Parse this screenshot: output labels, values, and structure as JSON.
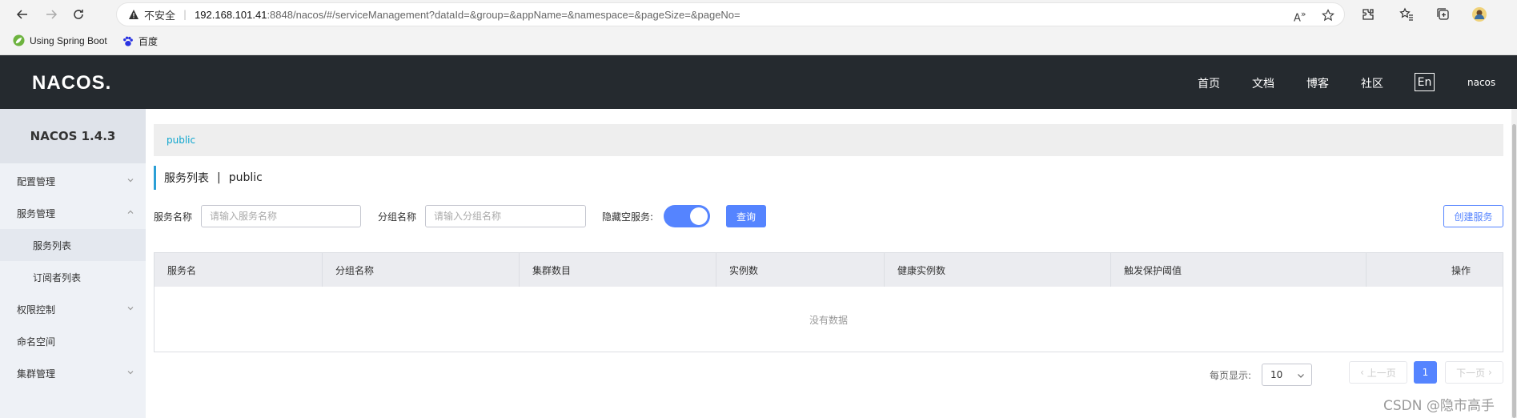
{
  "browser": {
    "insecure_label": "不安全",
    "url_host": "192.168.101.41",
    "url_rest": ":8848/nacos/#/serviceManagement?dataId=&group=&appName=&namespace=&pageSize=&pageNo=",
    "bookmarks": [
      {
        "label": "Using Spring Boot",
        "icon": "spring-leaf-icon"
      },
      {
        "label": "百度",
        "icon": "baidu-paw-icon"
      }
    ]
  },
  "header": {
    "logo": "NACOS.",
    "menu": [
      "首页",
      "文档",
      "博客",
      "社区"
    ],
    "lang": "En",
    "user": "nacos"
  },
  "sidebar": {
    "title": "NACOS 1.4.3",
    "items": [
      {
        "label": "配置管理",
        "type": "group",
        "expanded": false
      },
      {
        "label": "服务管理",
        "type": "group",
        "expanded": true
      },
      {
        "label": "服务列表",
        "type": "sub",
        "active": true
      },
      {
        "label": "订阅者列表",
        "type": "sub"
      },
      {
        "label": "权限控制",
        "type": "group",
        "expanded": false
      },
      {
        "label": "命名空间",
        "type": "item"
      },
      {
        "label": "集群管理",
        "type": "group",
        "expanded": false
      }
    ]
  },
  "main": {
    "breadcrumb": "public",
    "title": "服务列表",
    "title_sep": "|",
    "title_ns": "public",
    "filters": {
      "service_name_label": "服务名称",
      "service_name_placeholder": "请输入服务名称",
      "group_name_label": "分组名称",
      "group_name_placeholder": "请输入分组名称",
      "hide_empty_label": "隐藏空服务:",
      "hide_empty_on": true,
      "query_button": "查询",
      "create_button": "创建服务"
    },
    "table": {
      "columns": [
        "服务名",
        "分组名称",
        "集群数目",
        "实例数",
        "健康实例数",
        "触发保护阈值",
        "操作"
      ],
      "rows": [],
      "empty_text": "没有数据"
    },
    "pagination": {
      "per_page_label": "每页显示:",
      "per_page_value": "10",
      "prev": "上一页",
      "next": "下一页",
      "current_page": "1"
    }
  },
  "watermark": "CSDN @隐市高手",
  "colors": {
    "header_bg": "#252a2f",
    "primary": "#5584ff",
    "accent_border": "#2b9fd6",
    "link": "#0fa6ce"
  }
}
